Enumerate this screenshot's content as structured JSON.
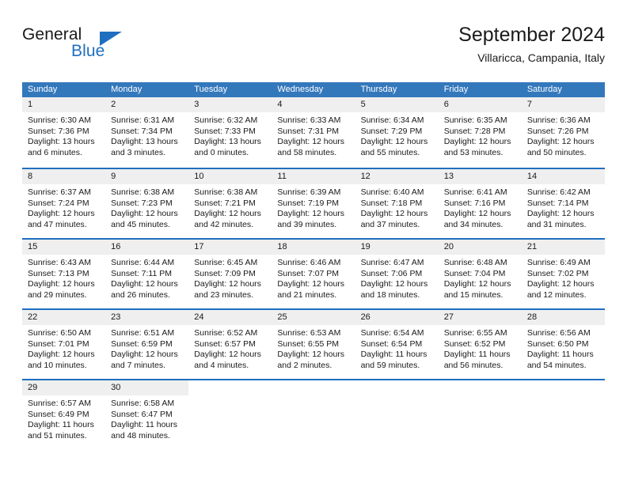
{
  "brand": {
    "name_part1": "General",
    "name_part2": "Blue",
    "logo_icon": "triangle-flag-icon"
  },
  "header": {
    "title": "September 2024",
    "subtitle": "Villaricca, Campania, Italy"
  },
  "calendar": {
    "weekdays": [
      "Sunday",
      "Monday",
      "Tuesday",
      "Wednesday",
      "Thursday",
      "Friday",
      "Saturday"
    ],
    "colors": {
      "header_blue": "#3478bc",
      "rule_blue": "#1f6fc0",
      "daynum_band": "#efefef",
      "text": "#1a1a1a"
    },
    "weeks": [
      [
        {
          "day": "1",
          "sunrise": "Sunrise: 6:30 AM",
          "sunset": "Sunset: 7:36 PM",
          "daylight1": "Daylight: 13 hours",
          "daylight2": "and 6 minutes."
        },
        {
          "day": "2",
          "sunrise": "Sunrise: 6:31 AM",
          "sunset": "Sunset: 7:34 PM",
          "daylight1": "Daylight: 13 hours",
          "daylight2": "and 3 minutes."
        },
        {
          "day": "3",
          "sunrise": "Sunrise: 6:32 AM",
          "sunset": "Sunset: 7:33 PM",
          "daylight1": "Daylight: 13 hours",
          "daylight2": "and 0 minutes."
        },
        {
          "day": "4",
          "sunrise": "Sunrise: 6:33 AM",
          "sunset": "Sunset: 7:31 PM",
          "daylight1": "Daylight: 12 hours",
          "daylight2": "and 58 minutes."
        },
        {
          "day": "5",
          "sunrise": "Sunrise: 6:34 AM",
          "sunset": "Sunset: 7:29 PM",
          "daylight1": "Daylight: 12 hours",
          "daylight2": "and 55 minutes."
        },
        {
          "day": "6",
          "sunrise": "Sunrise: 6:35 AM",
          "sunset": "Sunset: 7:28 PM",
          "daylight1": "Daylight: 12 hours",
          "daylight2": "and 53 minutes."
        },
        {
          "day": "7",
          "sunrise": "Sunrise: 6:36 AM",
          "sunset": "Sunset: 7:26 PM",
          "daylight1": "Daylight: 12 hours",
          "daylight2": "and 50 minutes."
        }
      ],
      [
        {
          "day": "8",
          "sunrise": "Sunrise: 6:37 AM",
          "sunset": "Sunset: 7:24 PM",
          "daylight1": "Daylight: 12 hours",
          "daylight2": "and 47 minutes."
        },
        {
          "day": "9",
          "sunrise": "Sunrise: 6:38 AM",
          "sunset": "Sunset: 7:23 PM",
          "daylight1": "Daylight: 12 hours",
          "daylight2": "and 45 minutes."
        },
        {
          "day": "10",
          "sunrise": "Sunrise: 6:38 AM",
          "sunset": "Sunset: 7:21 PM",
          "daylight1": "Daylight: 12 hours",
          "daylight2": "and 42 minutes."
        },
        {
          "day": "11",
          "sunrise": "Sunrise: 6:39 AM",
          "sunset": "Sunset: 7:19 PM",
          "daylight1": "Daylight: 12 hours",
          "daylight2": "and 39 minutes."
        },
        {
          "day": "12",
          "sunrise": "Sunrise: 6:40 AM",
          "sunset": "Sunset: 7:18 PM",
          "daylight1": "Daylight: 12 hours",
          "daylight2": "and 37 minutes."
        },
        {
          "day": "13",
          "sunrise": "Sunrise: 6:41 AM",
          "sunset": "Sunset: 7:16 PM",
          "daylight1": "Daylight: 12 hours",
          "daylight2": "and 34 minutes."
        },
        {
          "day": "14",
          "sunrise": "Sunrise: 6:42 AM",
          "sunset": "Sunset: 7:14 PM",
          "daylight1": "Daylight: 12 hours",
          "daylight2": "and 31 minutes."
        }
      ],
      [
        {
          "day": "15",
          "sunrise": "Sunrise: 6:43 AM",
          "sunset": "Sunset: 7:13 PM",
          "daylight1": "Daylight: 12 hours",
          "daylight2": "and 29 minutes."
        },
        {
          "day": "16",
          "sunrise": "Sunrise: 6:44 AM",
          "sunset": "Sunset: 7:11 PM",
          "daylight1": "Daylight: 12 hours",
          "daylight2": "and 26 minutes."
        },
        {
          "day": "17",
          "sunrise": "Sunrise: 6:45 AM",
          "sunset": "Sunset: 7:09 PM",
          "daylight1": "Daylight: 12 hours",
          "daylight2": "and 23 minutes."
        },
        {
          "day": "18",
          "sunrise": "Sunrise: 6:46 AM",
          "sunset": "Sunset: 7:07 PM",
          "daylight1": "Daylight: 12 hours",
          "daylight2": "and 21 minutes."
        },
        {
          "day": "19",
          "sunrise": "Sunrise: 6:47 AM",
          "sunset": "Sunset: 7:06 PM",
          "daylight1": "Daylight: 12 hours",
          "daylight2": "and 18 minutes."
        },
        {
          "day": "20",
          "sunrise": "Sunrise: 6:48 AM",
          "sunset": "Sunset: 7:04 PM",
          "daylight1": "Daylight: 12 hours",
          "daylight2": "and 15 minutes."
        },
        {
          "day": "21",
          "sunrise": "Sunrise: 6:49 AM",
          "sunset": "Sunset: 7:02 PM",
          "daylight1": "Daylight: 12 hours",
          "daylight2": "and 12 minutes."
        }
      ],
      [
        {
          "day": "22",
          "sunrise": "Sunrise: 6:50 AM",
          "sunset": "Sunset: 7:01 PM",
          "daylight1": "Daylight: 12 hours",
          "daylight2": "and 10 minutes."
        },
        {
          "day": "23",
          "sunrise": "Sunrise: 6:51 AM",
          "sunset": "Sunset: 6:59 PM",
          "daylight1": "Daylight: 12 hours",
          "daylight2": "and 7 minutes."
        },
        {
          "day": "24",
          "sunrise": "Sunrise: 6:52 AM",
          "sunset": "Sunset: 6:57 PM",
          "daylight1": "Daylight: 12 hours",
          "daylight2": "and 4 minutes."
        },
        {
          "day": "25",
          "sunrise": "Sunrise: 6:53 AM",
          "sunset": "Sunset: 6:55 PM",
          "daylight1": "Daylight: 12 hours",
          "daylight2": "and 2 minutes."
        },
        {
          "day": "26",
          "sunrise": "Sunrise: 6:54 AM",
          "sunset": "Sunset: 6:54 PM",
          "daylight1": "Daylight: 11 hours",
          "daylight2": "and 59 minutes."
        },
        {
          "day": "27",
          "sunrise": "Sunrise: 6:55 AM",
          "sunset": "Sunset: 6:52 PM",
          "daylight1": "Daylight: 11 hours",
          "daylight2": "and 56 minutes."
        },
        {
          "day": "28",
          "sunrise": "Sunrise: 6:56 AM",
          "sunset": "Sunset: 6:50 PM",
          "daylight1": "Daylight: 11 hours",
          "daylight2": "and 54 minutes."
        }
      ],
      [
        {
          "day": "29",
          "sunrise": "Sunrise: 6:57 AM",
          "sunset": "Sunset: 6:49 PM",
          "daylight1": "Daylight: 11 hours",
          "daylight2": "and 51 minutes."
        },
        {
          "day": "30",
          "sunrise": "Sunrise: 6:58 AM",
          "sunset": "Sunset: 6:47 PM",
          "daylight1": "Daylight: 11 hours",
          "daylight2": "and 48 minutes."
        },
        {
          "day": "",
          "sunrise": "",
          "sunset": "",
          "daylight1": "",
          "daylight2": ""
        },
        {
          "day": "",
          "sunrise": "",
          "sunset": "",
          "daylight1": "",
          "daylight2": ""
        },
        {
          "day": "",
          "sunrise": "",
          "sunset": "",
          "daylight1": "",
          "daylight2": ""
        },
        {
          "day": "",
          "sunrise": "",
          "sunset": "",
          "daylight1": "",
          "daylight2": ""
        },
        {
          "day": "",
          "sunrise": "",
          "sunset": "",
          "daylight1": "",
          "daylight2": ""
        }
      ]
    ]
  }
}
